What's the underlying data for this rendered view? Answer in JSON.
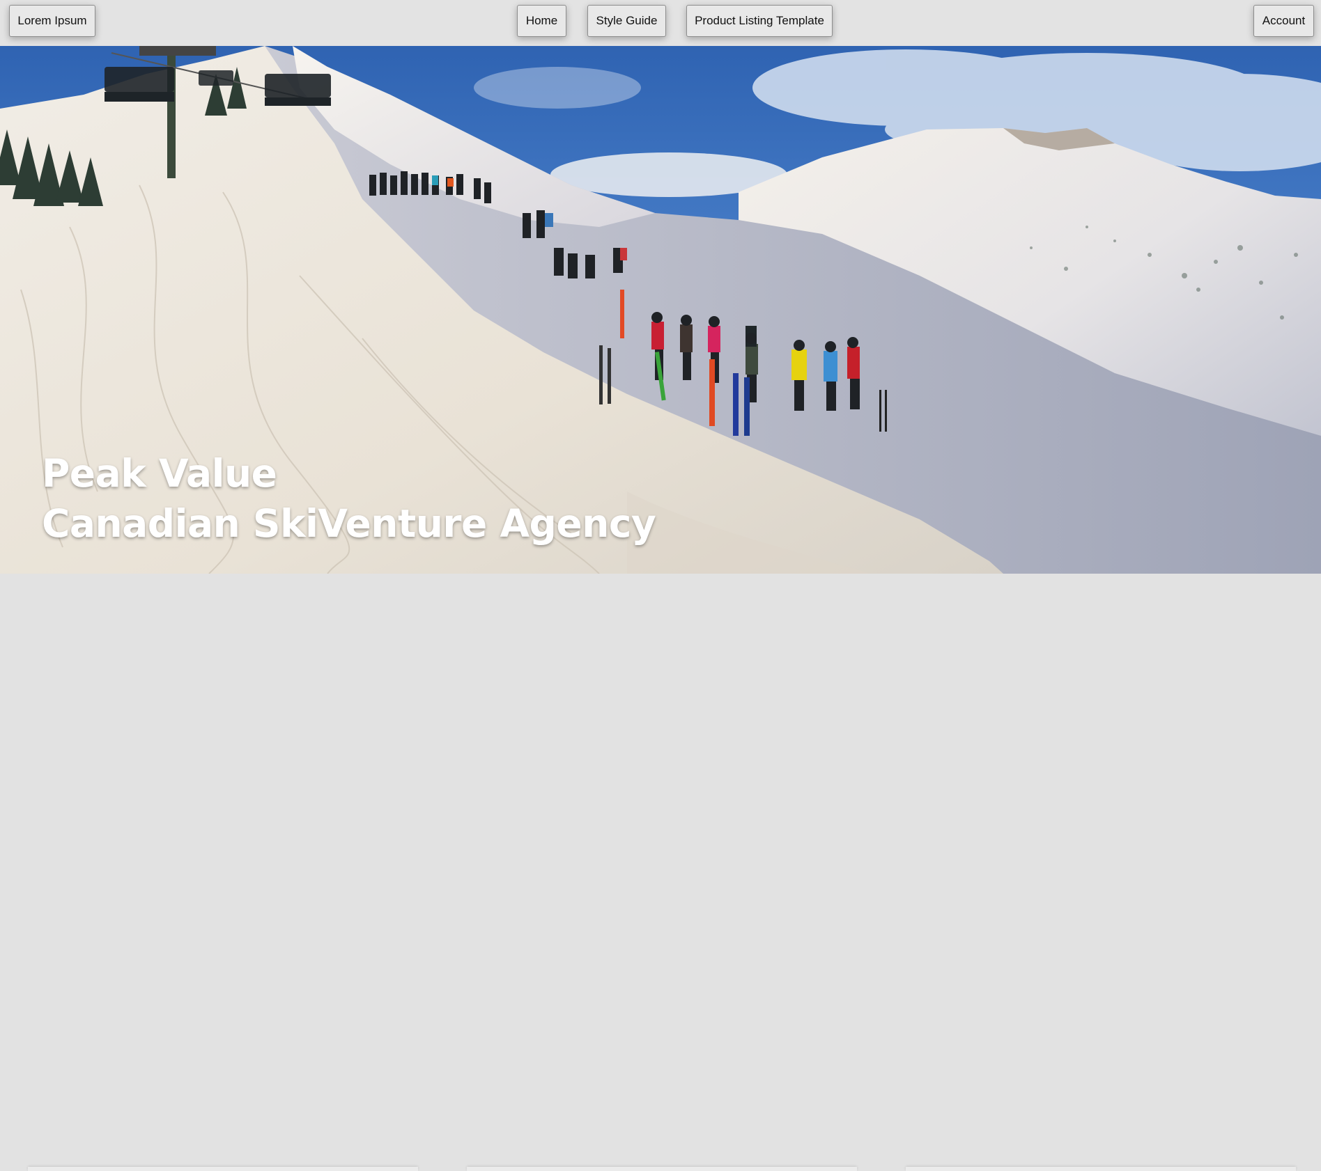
{
  "nav": {
    "brand": "Lorem Ipsum",
    "home": "Home",
    "style_guide": "Style Guide",
    "product_listing": "Product Listing Template",
    "account": "Account"
  },
  "hero": {
    "title_line1": "Peak Value",
    "title_line2": "Canadian SkiVenture Agency"
  },
  "colors": {
    "nav_bg": "#e3e3e3",
    "button_bg": "#e8e8e8",
    "sky_blue": "#3d74c2",
    "snow": "#f3efe8",
    "title_text": "#ffffff"
  }
}
